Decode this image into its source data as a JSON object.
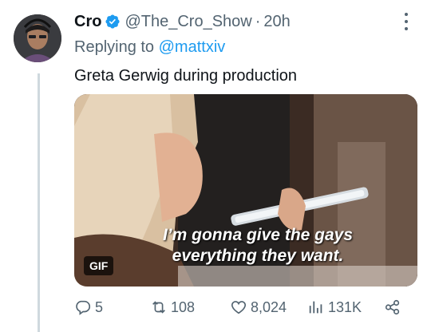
{
  "tweet": {
    "author_name": "Cro",
    "handle": "@The_Cro_Show",
    "separator": "·",
    "time": "20h",
    "replying_prefix": "Replying to",
    "replying_to": "@mattxiv",
    "text": "Greta Gerwig during production",
    "gif_caption_line1": "I’m gonna give the gays",
    "gif_caption_line2": "everything they want.",
    "gif_badge": "GIF"
  },
  "actions": {
    "replies": "5",
    "reposts": "108",
    "likes": "8,024",
    "views": "131K"
  },
  "colors": {
    "accent": "#1d9bf0",
    "secondary_text": "#536471",
    "primary_text": "#0f1419",
    "thread_line": "#cfd9de"
  },
  "icons": [
    "verified-badge-icon",
    "more-options-icon",
    "reply-icon",
    "repost-icon",
    "like-icon",
    "views-icon",
    "share-icon"
  ]
}
